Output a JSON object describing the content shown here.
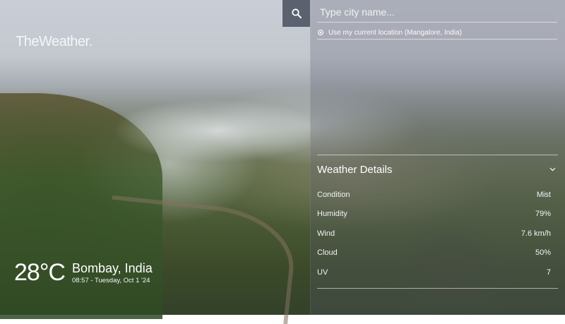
{
  "brand": {
    "name": "TheWeather."
  },
  "search": {
    "placeholder": "Type city name...",
    "value": "",
    "use_location_label": "Use my current location (Mangalore, India)"
  },
  "current": {
    "temperature": "28°C",
    "city": "Bombay, India",
    "datetime": "08:57 - Tuesday, Oct 1 '24"
  },
  "details": {
    "title": "Weather Details",
    "rows": [
      {
        "label": "Condition",
        "value": "Mist"
      },
      {
        "label": "Humidity",
        "value": "79%"
      },
      {
        "label": "Wind",
        "value": "7.6 km/h"
      },
      {
        "label": "Cloud",
        "value": "50%"
      },
      {
        "label": "UV",
        "value": "7"
      }
    ]
  },
  "icons": {
    "search": "search-icon",
    "location": "location-target-icon",
    "collapse": "chevron-down-icon"
  },
  "colors": {
    "search_button_bg": "#5c6170",
    "panel_tint": "rgba(95,95,110,0.28)",
    "text": "#ffffff"
  }
}
